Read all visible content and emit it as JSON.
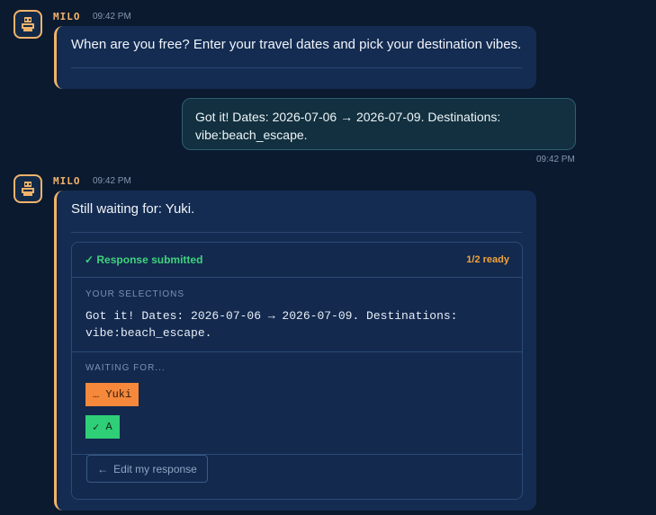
{
  "messages": [
    {
      "sender": "MILO",
      "time": "09:42 PM",
      "text": "When are you free? Enter your travel dates and pick your destination vibes."
    },
    {
      "sender": "user",
      "time": "09:42 PM",
      "text": "Got it! Dates: 2026-07-06 → 2026-07-09. Destinations: vibe:beach_escape."
    },
    {
      "sender": "MILO",
      "time": "09:42 PM",
      "text": "Still waiting for: Yuki."
    }
  ],
  "response_card": {
    "status": "✓ Response submitted",
    "ready": "1/2 ready",
    "selections_label": "YOUR SELECTIONS",
    "selections_text": "Got it! Dates: 2026-07-06 → 2026-07-09. Destinations: vibe:beach_escape.",
    "waiting_label": "WAITING FOR...",
    "waiting": [
      {
        "icon": "…",
        "name": "Yuki",
        "state": "pending"
      },
      {
        "icon": "✓",
        "name": "A",
        "state": "done"
      }
    ],
    "edit_label": "Edit my response",
    "edit_icon": "←"
  },
  "icons": {
    "avatar": "robot-icon"
  },
  "colors": {
    "background": "#0b1a2e",
    "accent": "#f2b36b",
    "success": "#3fd27d",
    "pending": "#f5883b"
  }
}
